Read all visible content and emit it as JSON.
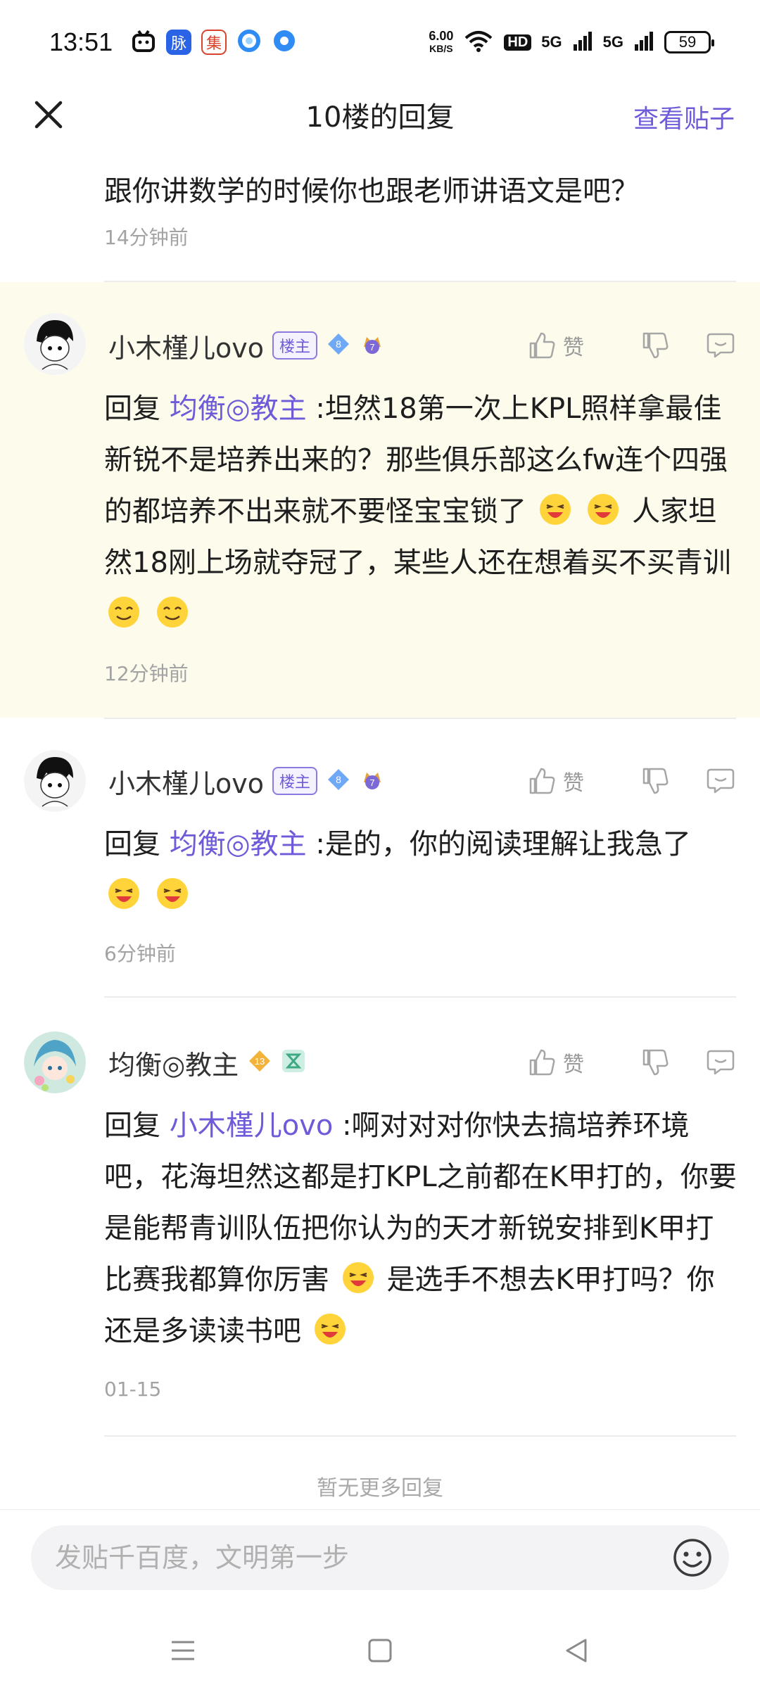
{
  "status_bar": {
    "time": "13:51",
    "app_icon_1": "脉",
    "app_icon_2": "集",
    "speed_value": "6.00",
    "speed_unit": "KB/S",
    "hd_label": "HD",
    "net1": "5G",
    "net2": "5G",
    "battery": "59"
  },
  "header": {
    "title": "10楼的回复",
    "view_post": "查看贴子"
  },
  "replies": [
    {
      "content": "跟你讲数学的时候你也跟老师讲语文是吧？",
      "time": "14分钟前"
    },
    {
      "username": "小木槿儿ovo",
      "owner_badge": "楼主",
      "level": "8",
      "rank": "7",
      "like_label": "赞",
      "reply_prefix": "回复",
      "mention": "均衡◎教主",
      "content": ":坦然18第一次上KPL照样拿最佳新锐不是培养出来的？那些俱乐部这么fw连个四强的都培养不出来就不要怪宝宝锁了",
      "content_2": "人家坦然18刚上场就夺冠了，某些人还在想着买不买青训",
      "time": "12分钟前"
    },
    {
      "username": "小木槿儿ovo",
      "owner_badge": "楼主",
      "level": "8",
      "rank": "7",
      "like_label": "赞",
      "reply_prefix": "回复",
      "mention": "均衡◎教主",
      "content": ":是的，你的阅读理解让我急了",
      "time": "6分钟前"
    },
    {
      "username": "均衡◎教主",
      "level": "13",
      "like_label": "赞",
      "reply_prefix": "回复",
      "mention": "小木槿儿ovo",
      "content": ":啊对对对你快去搞培养环境吧，花海坦然这都是打KPL之前都在K甲打的，你要是能帮青训队伍把你认为的天才新锐安排到K甲打比赛我都算你厉害",
      "content_2": "是选手不想去K甲打吗？你还是多读读书吧",
      "time": "01-15"
    }
  ],
  "footer": {
    "no_more": "暂无更多回复",
    "composer_placeholder": "发贴千百度，文明第一步"
  },
  "colors": {
    "accent": "#6e5bd9",
    "highlight_bg": "#fdfcec",
    "muted": "#a3a3a3"
  },
  "icons": [
    "close-icon",
    "thumb-up-icon",
    "thumb-down-icon",
    "comment-icon",
    "emoji-icon",
    "menu-icon",
    "home-icon",
    "back-icon"
  ]
}
